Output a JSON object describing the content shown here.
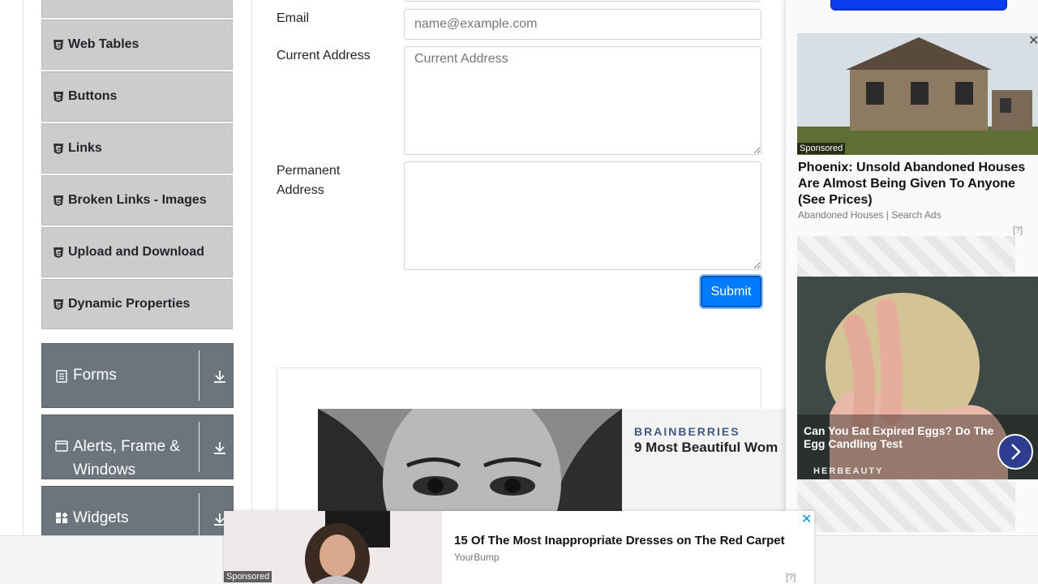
{
  "sidebar": {
    "elements_items": [
      {
        "label": "Web Tables",
        "icon": "html5-icon"
      },
      {
        "label": "Buttons",
        "icon": "html5-icon"
      },
      {
        "label": "Links",
        "icon": "html5-icon"
      },
      {
        "label": "Broken Links - Images",
        "icon": "html5-icon"
      },
      {
        "label": "Upload and Download",
        "icon": "html5-icon"
      },
      {
        "label": "Dynamic Properties",
        "icon": "html5-icon"
      }
    ],
    "groups": [
      {
        "label": "Forms",
        "icon": "form-list-icon"
      },
      {
        "label": "Alerts, Frame & Windows",
        "icon": "window-icon"
      },
      {
        "label": "Widgets",
        "icon": "widgets-icon"
      }
    ]
  },
  "form": {
    "email_label": "Email",
    "email_placeholder": "name@example.com",
    "current_address_label": "Current Address",
    "current_address_placeholder": "Current Address",
    "permanent_address_label_line1": "Permanent",
    "permanent_address_label_line2": "Address",
    "submit_label": "Submit"
  },
  "ads": {
    "right_top": {
      "sponsored": "Sponsored",
      "title": "Phoenix: Unsold Abandoned Houses Are Almost Being Given To Anyone (See Prices)",
      "source": "Abandoned Houses | Search Ads",
      "adchoice": "[?]"
    },
    "right_bottom": {
      "title": "Can You Eat Expired Eggs? Do The Egg Candling Test",
      "brand": "HERBEAUTY"
    },
    "middle": {
      "brand": "BRAINBERRIES",
      "headline": "9 Most Beautiful Wom"
    },
    "bottom": {
      "sponsored": "Sponsored",
      "title": "15 Of The Most Inappropriate Dresses on The Red Carpet",
      "source": "YourBump",
      "adchoice": "[?]",
      "close": "✕"
    },
    "close_symbol": "✕"
  },
  "colors": {
    "accent": "#007bff",
    "sidebar_group": "#6c757d",
    "sidebar_item": "#cccccc"
  }
}
